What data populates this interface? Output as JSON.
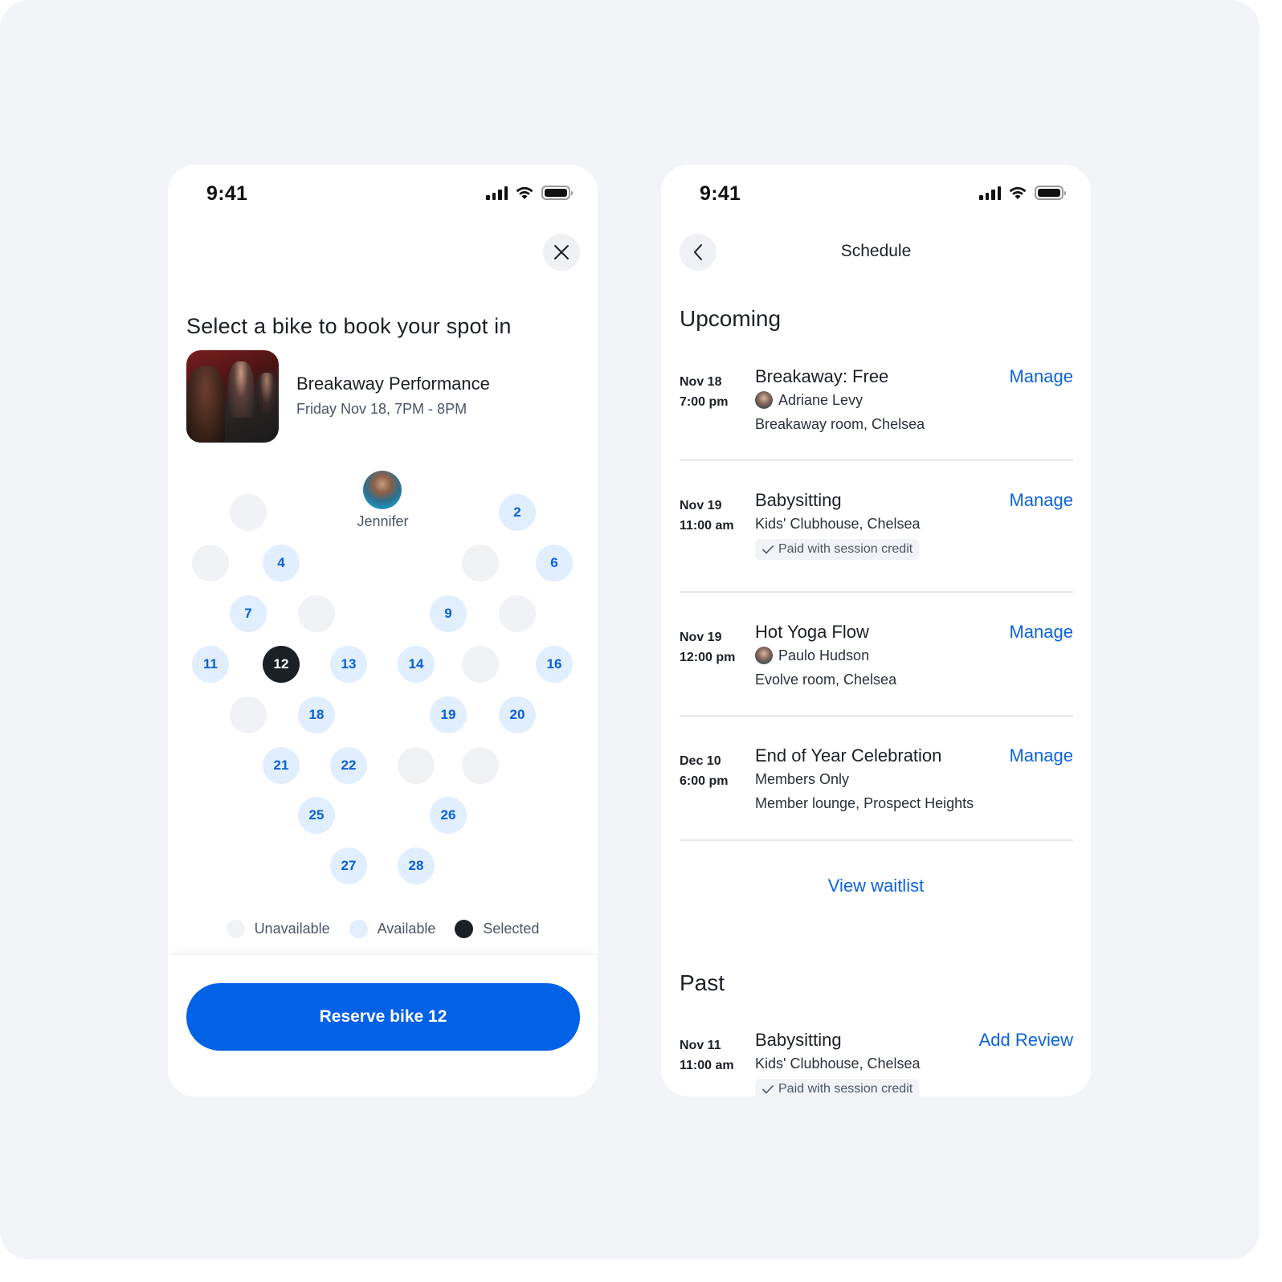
{
  "colors": {
    "accent": "#0162e6",
    "link": "#0a63de",
    "available_fill": "#e1eefe",
    "unavailable_fill": "#f1f2f6",
    "selected_fill": "#1b1f26",
    "background": "#f2f4f8"
  },
  "left_screen": {
    "status_time": "9:41",
    "close_icon": "close-icon",
    "headline": "Select a bike to book your spot in",
    "class": {
      "title": "Breakaway Performance",
      "time": "Friday Nov 18, 7PM - 8PM"
    },
    "instructor": {
      "name": "Jennifer"
    },
    "seats": [
      {
        "label": "",
        "status": "unavailable",
        "row": 1,
        "col": 2
      },
      {
        "label": "2",
        "status": "available",
        "row": 1,
        "col": 10
      },
      {
        "label": "",
        "status": "unavailable",
        "row": 2,
        "col": 1
      },
      {
        "label": "4",
        "status": "available",
        "row": 2,
        "col": 3
      },
      {
        "label": "",
        "status": "unavailable",
        "row": 2,
        "col": 9
      },
      {
        "label": "6",
        "status": "available",
        "row": 2,
        "col": 11
      },
      {
        "label": "7",
        "status": "available",
        "row": 3,
        "col": 2
      },
      {
        "label": "",
        "status": "unavailable",
        "row": 3,
        "col": 4
      },
      {
        "label": "9",
        "status": "available",
        "row": 3,
        "col": 8
      },
      {
        "label": "",
        "status": "unavailable",
        "row": 3,
        "col": 10
      },
      {
        "label": "11",
        "status": "available",
        "row": 4,
        "col": 1
      },
      {
        "label": "12",
        "status": "selected",
        "row": 4,
        "col": 3
      },
      {
        "label": "13",
        "status": "available",
        "row": 4,
        "col": 5
      },
      {
        "label": "14",
        "status": "available",
        "row": 4,
        "col": 7
      },
      {
        "label": "",
        "status": "unavailable",
        "row": 4,
        "col": 9
      },
      {
        "label": "16",
        "status": "available",
        "row": 4,
        "col": 11
      },
      {
        "label": "",
        "status": "unavailable",
        "row": 5,
        "col": 2
      },
      {
        "label": "18",
        "status": "available",
        "row": 5,
        "col": 4
      },
      {
        "label": "19",
        "status": "available",
        "row": 5,
        "col": 8
      },
      {
        "label": "20",
        "status": "available",
        "row": 5,
        "col": 10
      },
      {
        "label": "21",
        "status": "available",
        "row": 6,
        "col": 3
      },
      {
        "label": "22",
        "status": "available",
        "row": 6,
        "col": 5
      },
      {
        "label": "",
        "status": "unavailable",
        "row": 6,
        "col": 7
      },
      {
        "label": "",
        "status": "unavailable",
        "row": 6,
        "col": 9
      },
      {
        "label": "25",
        "status": "available",
        "row": 7,
        "col": 4
      },
      {
        "label": "26",
        "status": "available",
        "row": 7,
        "col": 8
      },
      {
        "label": "27",
        "status": "available",
        "row": 8,
        "col": 5
      },
      {
        "label": "28",
        "status": "available",
        "row": 8,
        "col": 7
      }
    ],
    "legend": {
      "unavailable": "Unavailable",
      "available": "Available",
      "selected": "Selected"
    },
    "reserve_button": "Reserve bike 12"
  },
  "right_screen": {
    "status_time": "9:41",
    "back_icon": "chevron-left-icon",
    "title": "Schedule",
    "upcoming_title": "Upcoming",
    "upcoming": [
      {
        "date": "Nov 18",
        "time": "7:00 pm",
        "title": "Breakaway: Free",
        "instructor": "Adriane Levy",
        "location": "Breakaway room, Chelsea",
        "action": "Manage"
      },
      {
        "date": "Nov 19",
        "time": "11:00 am",
        "title": "Babysitting",
        "location": "Kids' Clubhouse, Chelsea",
        "badge": "Paid with session credit",
        "action": "Manage"
      },
      {
        "date": "Nov 19",
        "time": "12:00 pm",
        "title": "Hot Yoga Flow",
        "instructor": "Paulo Hudson",
        "location": "Evolve room, Chelsea",
        "action": "Manage"
      },
      {
        "date": "Dec 10",
        "time": "6:00 pm",
        "title": "End of Year Celebration",
        "subtitle": "Members Only",
        "location": "Member lounge, Prospect Heights",
        "action": "Manage"
      }
    ],
    "waitlist_link": "View waitlist",
    "past_title": "Past",
    "past": [
      {
        "date": "Nov 11",
        "time": "11:00 am",
        "title": "Babysitting",
        "location": "Kids' Clubhouse, Chelsea",
        "badge": "Paid with session credit",
        "action": "Add Review"
      }
    ]
  }
}
